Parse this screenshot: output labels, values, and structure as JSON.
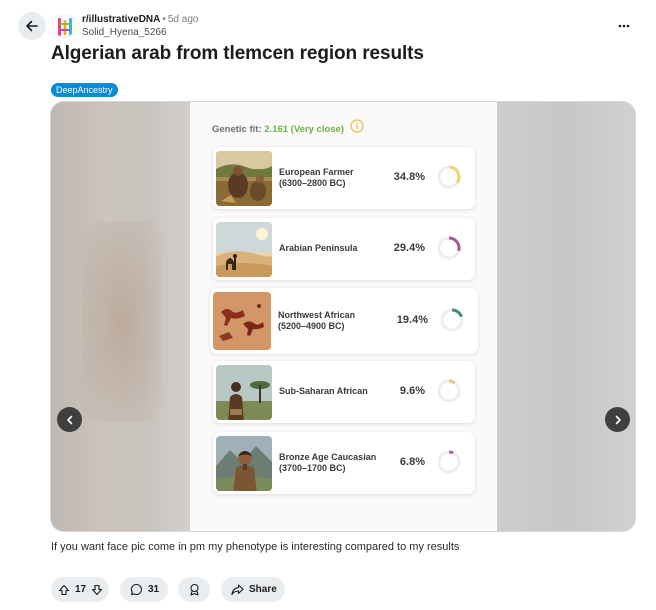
{
  "header": {
    "subreddit": "r/illustrativeDNA",
    "separator": "•",
    "time": "5d ago",
    "username": "Solid_Hyena_5266"
  },
  "post": {
    "title": "Algerian arab from tlemcen region results",
    "flair": "DeepAncestry",
    "body": "If you want face pic come in pm my phenotype is interesting compared to my results"
  },
  "slide": {
    "fit_label": "Genetic fit:",
    "fit_value": "2.161 (Very close)",
    "populations": [
      {
        "name_line1": "European Farmer",
        "name_line2": "(6300–2800 BC)",
        "percent": "34.8%",
        "ring_value": 0.348,
        "ring_color": "#e8d86a"
      },
      {
        "name_line1": "Arabian Peninsula",
        "name_line2": "",
        "percent": "29.4%",
        "ring_value": 0.294,
        "ring_color": "#a4578e"
      },
      {
        "name_line1": "Northwest African",
        "name_line2": "(5200–4900 BC)",
        "percent": "19.4%",
        "ring_value": 0.194,
        "ring_color": "#3f8f7f"
      },
      {
        "name_line1": "Sub-Saharan African",
        "name_line2": "",
        "percent": "9.6%",
        "ring_value": 0.096,
        "ring_color": "#e6c98a"
      },
      {
        "name_line1": "Bronze Age Caucasian",
        "name_line2": "(3700–1700 BC)",
        "percent": "6.8%",
        "ring_value": 0.068,
        "ring_color": "#b06aa0"
      }
    ],
    "page_count": 4,
    "active_page": 2
  },
  "actions": {
    "vote_count": "17",
    "comment_count": "31",
    "share_label": "Share"
  }
}
